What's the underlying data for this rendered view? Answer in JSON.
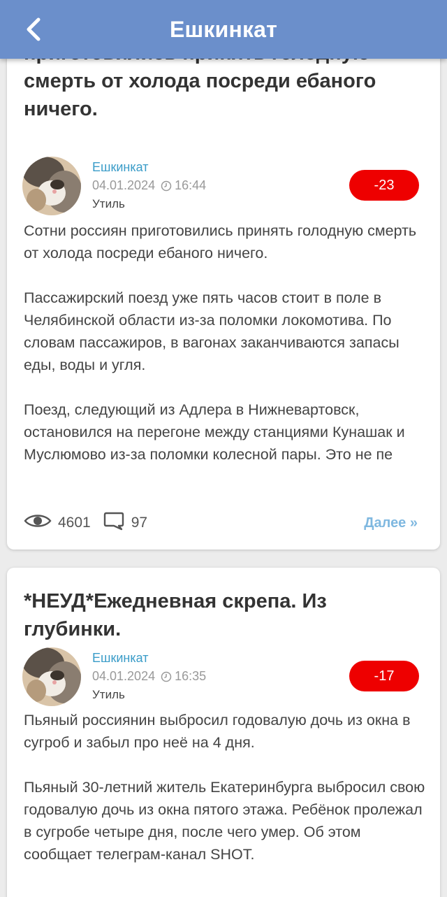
{
  "header": {
    "title": "Ешкинкат"
  },
  "posts": [
    {
      "title": "приготовились принять голодную смерть от холода посреди ебаного ничего.",
      "author": "Ешкинкат",
      "date": "04.01.2024",
      "time": "16:44",
      "category": "Утиль",
      "rating": "-23",
      "body": [
        "Сотни россиян приготовились принять голодную смерть от холода посреди ебаного ничего.",
        "Пассажирский поезд уже пять часов стоит в поле в Челябинской области из-за поломки локомотива. По словам пассажиров, в вагонах заканчиваются запасы еды, воды и угля.",
        "Поезд, следующий из Адлера в Нижневартовск, остановился на перегоне между станциями Кунашак и Муслюмово из-за поломки колесной пары. Это не пе"
      ],
      "views": "4601",
      "comments": "97",
      "more": "Далее »"
    },
    {
      "title": "*НЕУД*Ежедневная скрепа. Из глубинки.",
      "author": "Ешкинкат",
      "date": "04.01.2024",
      "time": "16:35",
      "category": "Утиль",
      "rating": "-17",
      "body": [
        "Пьяный россиянин выбросил годовалую дочь из окна в сугроб и забыл про неё на 4 дня.",
        "Пьяный 30-летний житель Екатеринбурга выбросил свою годовалую дочь из окна пятого этажа. Ребёнок пролежал в сугробе четыре дня, после чего умер. Об этом сообщает телеграм-канал SHOT."
      ]
    }
  ],
  "colors": {
    "header": "#6b8fcb",
    "rating": "#ee0000",
    "author": "#3a9cc8",
    "more": "#7fb8e0"
  },
  "icons": {
    "back": "chevron-left-icon",
    "clock": "clock-icon",
    "views": "eye-icon",
    "comments": "comment-icon"
  }
}
